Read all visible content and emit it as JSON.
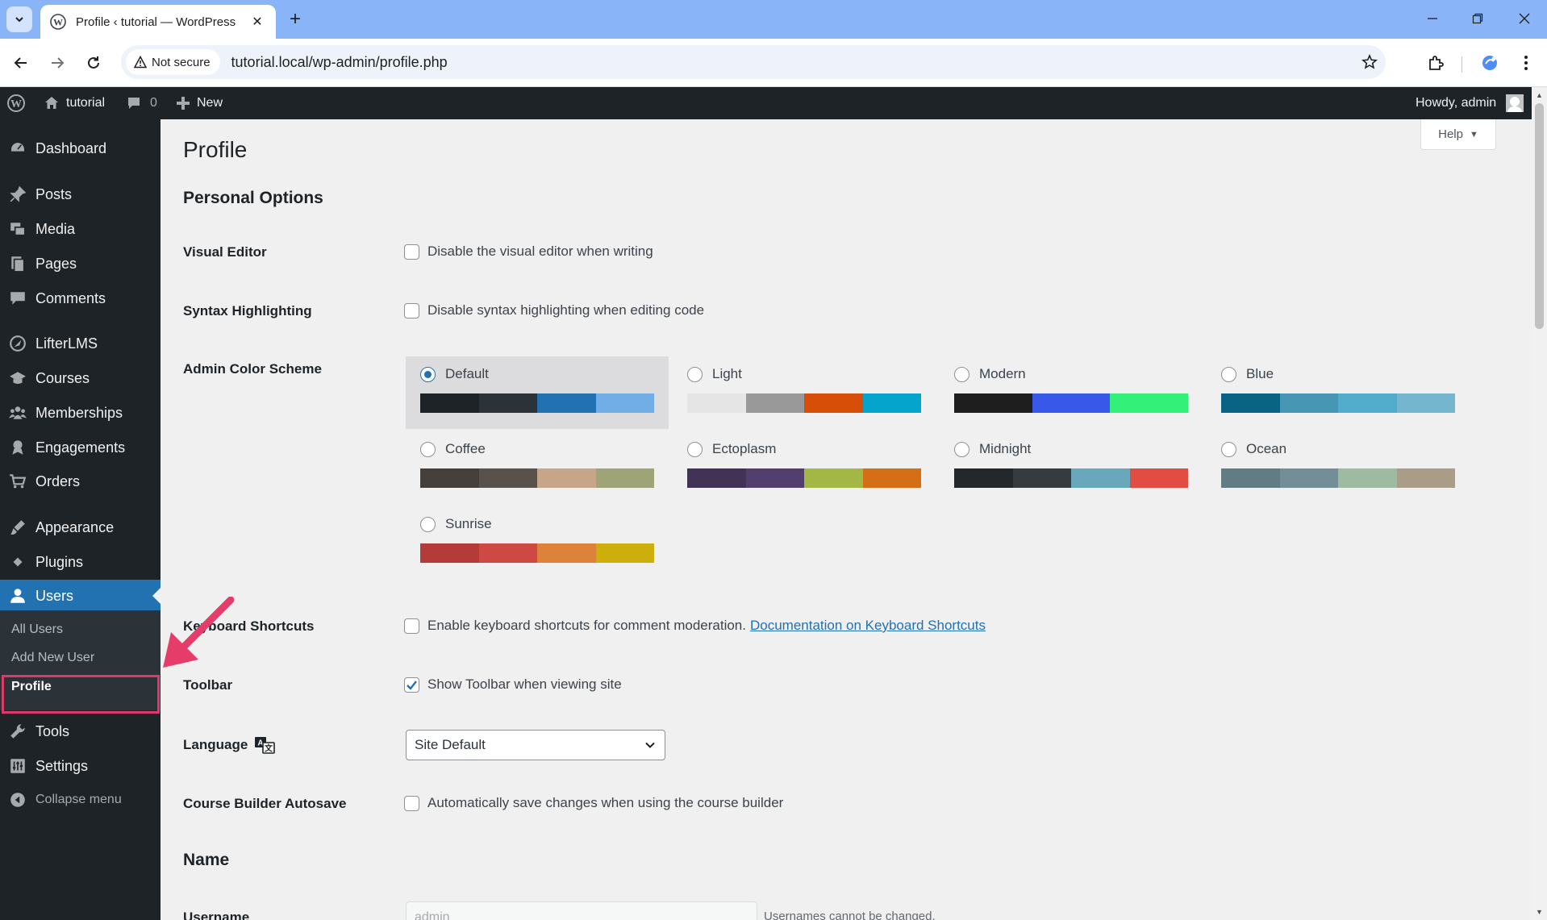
{
  "browser": {
    "tab_title": "Profile ‹ tutorial — WordPress",
    "security_label": "Not secure",
    "url": "tutorial.local/wp-admin/profile.php"
  },
  "adminbar": {
    "site_name": "tutorial",
    "comments_count": "0",
    "new_label": "New",
    "howdy": "Howdy, admin"
  },
  "sidebar": {
    "items": [
      {
        "label": "Dashboard",
        "icon": "dashboard-icon"
      },
      {
        "label": "Posts",
        "icon": "pin-icon"
      },
      {
        "label": "Media",
        "icon": "media-icon"
      },
      {
        "label": "Pages",
        "icon": "pages-icon"
      },
      {
        "label": "Comments",
        "icon": "comment-icon"
      },
      {
        "label": "LifterLMS",
        "icon": "rocket-icon"
      },
      {
        "label": "Courses",
        "icon": "graduation-cap-icon"
      },
      {
        "label": "Memberships",
        "icon": "groups-icon"
      },
      {
        "label": "Engagements",
        "icon": "award-icon"
      },
      {
        "label": "Orders",
        "icon": "cart-icon"
      },
      {
        "label": "Appearance",
        "icon": "brush-icon"
      },
      {
        "label": "Plugins",
        "icon": "plugin-icon"
      },
      {
        "label": "Users",
        "icon": "user-icon"
      },
      {
        "label": "Tools",
        "icon": "wrench-icon"
      },
      {
        "label": "Settings",
        "icon": "settings-icon"
      },
      {
        "label": "Collapse menu",
        "icon": "collapse-icon"
      }
    ],
    "submenu": [
      "All Users",
      "Add New User",
      "Profile"
    ]
  },
  "main": {
    "help_label": "Help",
    "page_title": "Profile",
    "personal_options_title": "Personal Options",
    "visual_editor": {
      "label": "Visual Editor",
      "checkbox": "Disable the visual editor when writing",
      "checked": false
    },
    "syntax_highlighting": {
      "label": "Syntax Highlighting",
      "checkbox": "Disable syntax highlighting when editing code",
      "checked": false
    },
    "color_scheme": {
      "label": "Admin Color Scheme",
      "selected": "Default",
      "schemes": [
        {
          "name": "Default",
          "colors": [
            "#1d2327",
            "#2c3338",
            "#2271b1",
            "#72aee6"
          ]
        },
        {
          "name": "Light",
          "colors": [
            "#e5e5e5",
            "#999999",
            "#d64e07",
            "#04a4cc"
          ]
        },
        {
          "name": "Modern",
          "colors": [
            "#1e1e1e",
            "#3858e9",
            "#33f078"
          ]
        },
        {
          "name": "Blue",
          "colors": [
            "#096484",
            "#4796b3",
            "#52accc",
            "#74b6ce"
          ]
        },
        {
          "name": "Coffee",
          "colors": [
            "#46403c",
            "#59524c",
            "#c7a589",
            "#9ea476"
          ]
        },
        {
          "name": "Ectoplasm",
          "colors": [
            "#413256",
            "#523f6d",
            "#a3b745",
            "#d46f15"
          ]
        },
        {
          "name": "Midnight",
          "colors": [
            "#25282b",
            "#363b3f",
            "#69a8bb",
            "#e14d43"
          ]
        },
        {
          "name": "Ocean",
          "colors": [
            "#627c83",
            "#738e96",
            "#9ebaa0",
            "#aa9d88"
          ]
        },
        {
          "name": "Sunrise",
          "colors": [
            "#b43c38",
            "#cf4944",
            "#dd823b",
            "#ccaf0b"
          ]
        }
      ]
    },
    "keyboard_shortcuts": {
      "label": "Keyboard Shortcuts",
      "checkbox": "Enable keyboard shortcuts for comment moderation.",
      "link": "Documentation on Keyboard Shortcuts",
      "checked": false
    },
    "toolbar": {
      "label": "Toolbar",
      "checkbox": "Show Toolbar when viewing site",
      "checked": true
    },
    "language": {
      "label": "Language",
      "value": "Site Default"
    },
    "course_builder": {
      "label": "Course Builder Autosave",
      "checkbox": "Automatically save changes when using the course builder",
      "checked": false
    },
    "name_title": "Name",
    "username": {
      "label": "Username",
      "value": "admin",
      "hint": "Usernames cannot be changed."
    }
  }
}
